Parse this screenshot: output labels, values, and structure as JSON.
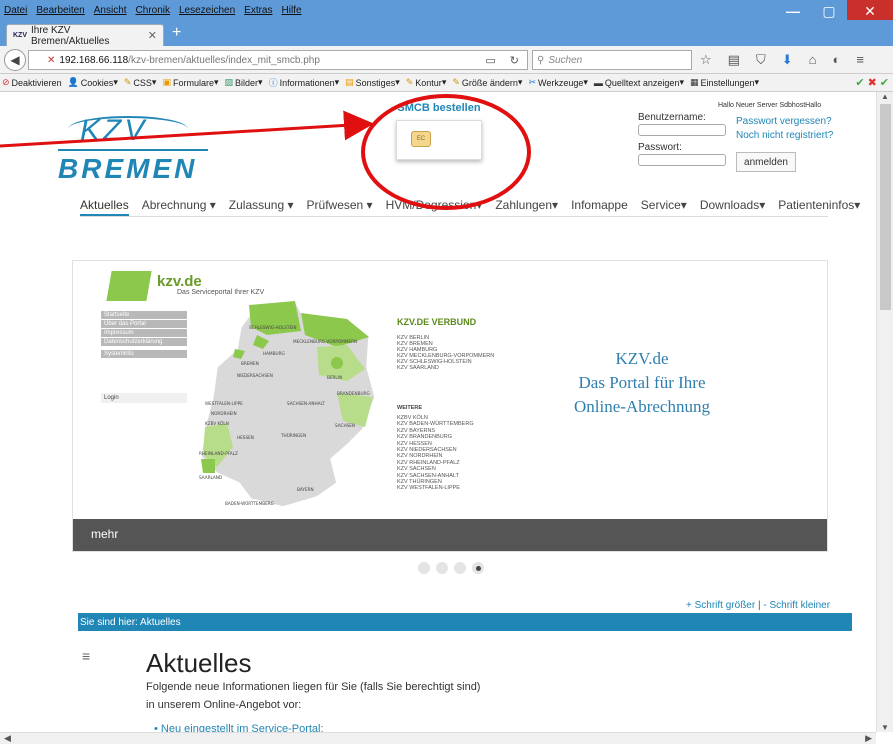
{
  "menubar": {
    "items": [
      "Datei",
      "Bearbeiten",
      "Ansicht",
      "Chronik",
      "Lesezeichen",
      "Extras",
      "Hilfe"
    ]
  },
  "tab": {
    "title": "Ihre KZV Bremen/Aktuelles",
    "favicon": "KZV"
  },
  "url": {
    "host": "192.168.66.118",
    "path": "/kzv-bremen/aktuelles/index_mit_smcb.php"
  },
  "search": {
    "placeholder": "Suchen"
  },
  "bookmarks": [
    {
      "label": "Deaktivieren",
      "icon": "no-entry-icon"
    },
    {
      "label": "Cookies",
      "icon": "person-icon"
    },
    {
      "label": "CSS",
      "icon": "pencil-icon"
    },
    {
      "label": "Formulare",
      "icon": "form-icon"
    },
    {
      "label": "Bilder",
      "icon": "image-icon"
    },
    {
      "label": "Informationen",
      "icon": "info-icon"
    },
    {
      "label": "Sonstiges",
      "icon": "note-icon"
    },
    {
      "label": "Kontur",
      "icon": "pen-icon"
    },
    {
      "label": "Größe ändern",
      "icon": "resize-icon"
    },
    {
      "label": "Werkzeuge",
      "icon": "tools-icon"
    },
    {
      "label": "Quelltext anzeigen",
      "icon": "source-icon"
    },
    {
      "label": "Einstellungen",
      "icon": "settings-icon"
    }
  ],
  "header": {
    "logo_top": "KZV",
    "logo_bottom": "BREMEN",
    "smcb_label": "SMCB bestellen",
    "chip_text": "EC"
  },
  "login": {
    "hello": "Hallo Neuer Server SdbhostHallo",
    "username_label": "Benutzername:",
    "password_label": "Passwort:",
    "forgot": "Passwort vergessen?",
    "register": "Noch nicht registriert?",
    "button": "anmelden"
  },
  "mainnav": [
    {
      "label": "Aktuelles"
    },
    {
      "label": "Abrechnung ▾"
    },
    {
      "label": "Zulassung ▾"
    },
    {
      "label": "Prüfwesen ▾"
    },
    {
      "label": "HVM/Degression▾"
    },
    {
      "label": "Zahlungen▾"
    },
    {
      "label": "Infomappe"
    },
    {
      "label": "Service▾"
    },
    {
      "label": "Downloads▾"
    },
    {
      "label": "Patienteninfos▾"
    }
  ],
  "slider": {
    "brand": "kzv.de",
    "subtitle": "Das Serviceportal Ihrer KZV",
    "sidemenu": [
      "Startseite",
      "Über das Portal",
      "Impressum",
      "Datenschutzerklärung",
      "Systeminfo"
    ],
    "login_label": "Login",
    "verbund_title": "KZV.DE VERBUND",
    "verbund_list": [
      "KZV BERLIN",
      "KZV BREMEN",
      "KZV HAMBURG",
      "KZV MECKLENBURG-VORPOMMERN",
      "KZV SCHLESWIG-HOLSTEIN",
      "KZV SAARLAND"
    ],
    "weitere_title": "WEITERE",
    "weitere_list": [
      "KZBV KÖLN",
      "KZV BADEN-WÜRTTEMBERG",
      "KZV BAYERNS",
      "KZV BRANDENBURG",
      "KZV HESSEN",
      "KZV NIEDERSACHSEN",
      "KZV NORDRHEIN",
      "KZV RHEINLAND-PFALZ",
      "KZV SACHSEN",
      "KZV SACHSEN-ANHALT",
      "KZV THÜRINGEN",
      "KZV WESTFALEN-LIPPE"
    ],
    "map_labels": [
      "SCHLESWIG-HOLSTEIN",
      "HAMBURG",
      "MECKLENBURG-VORPOMMERN",
      "BREMEN",
      "NIEDERSACHSEN",
      "BERLIN",
      "BRANDENBURG",
      "WESTFALEN-LIPPE",
      "NORDRHEIN",
      "SACHSEN-ANHALT",
      "KZBV KÖLN",
      "HESSEN",
      "THÜRINGEN",
      "SACHSEN",
      "RHEINLAND-PFALZ",
      "SAARLAND",
      "BAYERN",
      "BADEN-WÜRTTEMBERG"
    ],
    "portal_line1": "KZV.de",
    "portal_line2": "Das Portal für Ihre",
    "portal_line3": "Online-Abrechnung",
    "more": "mehr"
  },
  "dots": {
    "count": 4,
    "active": 4
  },
  "fontsize": {
    "bigger": "+ Schrift größer",
    "sep": "|",
    "smaller": "- Schrift kleiner"
  },
  "breadcrumb": "Sie sind hier: Aktuelles",
  "content": {
    "title": "Aktuelles",
    "intro_line1": "Folgende neue Informationen liegen für Sie (falls Sie berechtigt sind)",
    "intro_line2": "in unserem Online-Angebot vor:",
    "bullet": "Neu eingestellt im Service-Portal:"
  },
  "colors": {
    "accent": "#1f86b6",
    "kzvgreen": "#8cc84b",
    "annotation": "#e01010",
    "titlebar": "#5e9ad8"
  }
}
